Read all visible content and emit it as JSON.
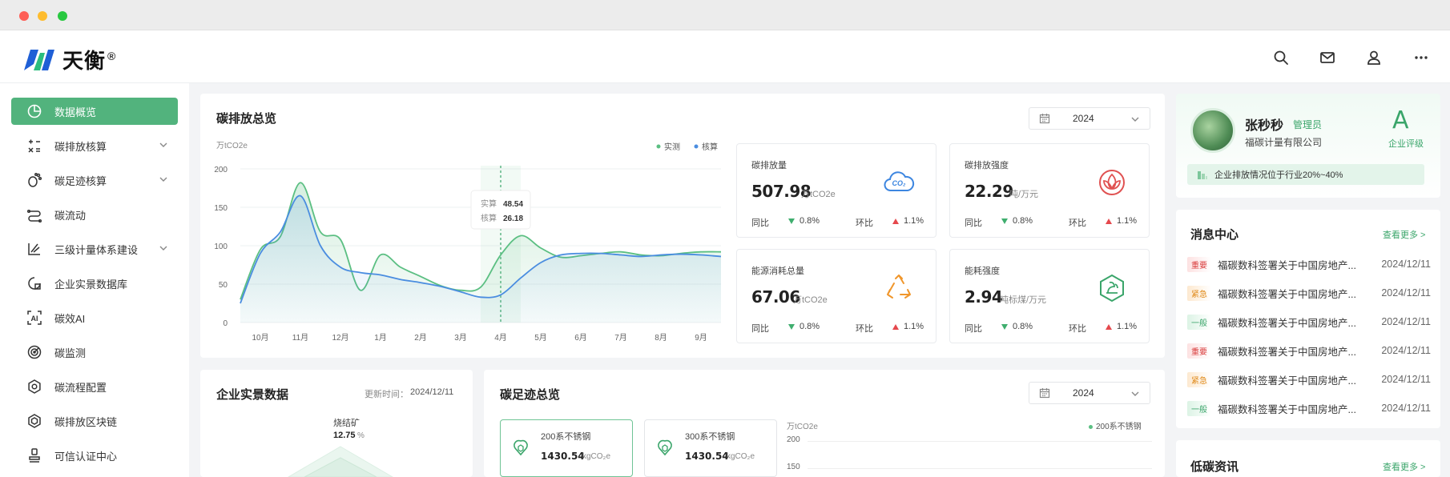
{
  "app": {
    "logo_text": "天衡",
    "logo_mark": "®"
  },
  "colors": {
    "accent": "#52b37d",
    "measured": "#5bbf82",
    "accounted": "#4a8de0",
    "up": "#e5484d",
    "down": "#3fae6e"
  },
  "header_icons": [
    "search-icon",
    "mail-icon",
    "user-icon",
    "more-icon"
  ],
  "sidebar": {
    "items": [
      {
        "label": "数据概览",
        "icon": "pie-chart-icon",
        "active": true,
        "expandable": false
      },
      {
        "label": "碳排放核算",
        "icon": "calculator-icon",
        "active": false,
        "expandable": true
      },
      {
        "label": "碳足迹核算",
        "icon": "footprint-icon",
        "active": false,
        "expandable": true
      },
      {
        "label": "碳流动",
        "icon": "flow-icon",
        "active": false,
        "expandable": false
      },
      {
        "label": "三级计量体系建设",
        "icon": "measure-icon",
        "active": false,
        "expandable": true
      },
      {
        "label": "企业实景数据库",
        "icon": "database-icon",
        "active": false,
        "expandable": false
      },
      {
        "label": "碳效AI",
        "icon": "ai-icon",
        "active": false,
        "expandable": false
      },
      {
        "label": "碳监测",
        "icon": "radar-icon",
        "active": false,
        "expandable": false
      },
      {
        "label": "碳流程配置",
        "icon": "settings-icon",
        "active": false,
        "expandable": false
      },
      {
        "label": "碳排放区块链",
        "icon": "blockchain-icon",
        "active": false,
        "expandable": false
      },
      {
        "label": "可信认证中心",
        "icon": "stamp-icon",
        "active": false,
        "expandable": false
      }
    ]
  },
  "overview": {
    "title": "碳排放总览",
    "year": "2024",
    "unit": "万tCO2e",
    "legend": {
      "measured": "实测",
      "accounted": "核算"
    },
    "tooltip": {
      "measured_label": "实算",
      "measured_value": "48.54",
      "accounted_label": "核算",
      "accounted_value": "26.18"
    },
    "metrics": [
      {
        "label": "碳排放量",
        "value": "507.98",
        "unit": "万tCO2e",
        "yoy_label": "同比",
        "yoy": "0.8%",
        "mom_label": "环比",
        "mom": "1.1%",
        "icon": "co2-cloud-icon",
        "icon_color": "#3d86e0"
      },
      {
        "label": "碳排放强度",
        "value": "22.29",
        "unit": "吨/万元",
        "yoy_label": "同比",
        "yoy": "0.8%",
        "mom_label": "环比",
        "mom": "1.1%",
        "icon": "lotus-icon",
        "icon_color": "#e05252"
      },
      {
        "label": "能源消耗总量",
        "value": "67.06",
        "unit": "万tCO2e",
        "yoy_label": "同比",
        "yoy": "0.8%",
        "mom_label": "环比",
        "mom": "1.1%",
        "icon": "recycle-icon",
        "icon_color": "#f0962b"
      },
      {
        "label": "能耗强度",
        "value": "2.94",
        "unit": "吨标煤/万元",
        "yoy_label": "同比",
        "yoy": "0.8%",
        "mom_label": "环比",
        "mom": "1.1%",
        "icon": "hexagon-leaf-icon",
        "icon_color": "#3aa56a"
      }
    ]
  },
  "chart_data": {
    "type": "area",
    "categories": [
      "10月",
      "11月",
      "12月",
      "1月",
      "2月",
      "3月",
      "4月",
      "5月",
      "6月",
      "7月",
      "8月",
      "9月"
    ],
    "ylim": [
      0,
      200
    ],
    "yticks": [
      0,
      50,
      100,
      150,
      200
    ],
    "ylabel": "万tCO2e",
    "x": [
      -0.5,
      0,
      0.5,
      1,
      1.5,
      2,
      2.5,
      3,
      3.5,
      4,
      4.5,
      5,
      5.5,
      6,
      6.5,
      7,
      7.5,
      8,
      8.5,
      9,
      9.5,
      10,
      10.5,
      11,
      11.5
    ],
    "series": [
      {
        "name": "实测",
        "values": [
          30,
          95,
          112,
          182,
          118,
          108,
          42,
          88,
          72,
          60,
          48,
          42,
          46,
          88,
          113,
          97,
          85,
          87,
          90,
          92,
          88,
          87,
          90,
          92,
          92
        ]
      },
      {
        "name": "核算",
        "values": [
          25,
          90,
          118,
          165,
          100,
          72,
          65,
          62,
          56,
          52,
          47,
          40,
          33,
          36,
          58,
          78,
          88,
          90,
          90,
          88,
          86,
          88,
          89,
          88,
          86
        ]
      }
    ],
    "highlight_category": "4月"
  },
  "profile": {
    "name": "张秒秒",
    "role": "管理员",
    "company": "福碳计量有限公司",
    "grade": "A",
    "grade_label": "企业评级",
    "notice": "企业排放情况位于行业20%~40%"
  },
  "messages": {
    "title": "消息中心",
    "more": "查看更多 >",
    "items": [
      {
        "tag": "重要",
        "level": "red",
        "text": "福碳数科签署关于中国房地产...",
        "date": "2024/12/11"
      },
      {
        "tag": "紧急",
        "level": "orange",
        "text": "福碳数科签署关于中国房地产...",
        "date": "2024/12/11"
      },
      {
        "tag": "一般",
        "level": "green",
        "text": "福碳数科签署关于中国房地产...",
        "date": "2024/12/11"
      },
      {
        "tag": "重要",
        "level": "red",
        "text": "福碳数科签署关于中国房地产...",
        "date": "2024/12/11"
      },
      {
        "tag": "紧急",
        "level": "orange",
        "text": "福碳数科签署关于中国房地产...",
        "date": "2024/12/11"
      },
      {
        "tag": "一般",
        "level": "green",
        "text": "福碳数科签署关于中国房地产...",
        "date": "2024/12/11"
      }
    ]
  },
  "news": {
    "title": "低碳资讯",
    "more": "查看更多 >"
  },
  "enterprise": {
    "title": "企业实景数据",
    "update_label": "更新时间：",
    "update_time": "2024/12/11",
    "item_label": "烧结矿",
    "item_value": "12.75",
    "item_unit": "%"
  },
  "footprint": {
    "title": "碳足迹总览",
    "year": "2024",
    "unit": "万tCO2e",
    "legend": "200系不锈钢",
    "yticks": [
      "200",
      "150"
    ],
    "cards": [
      {
        "name": "200系不锈钢",
        "value": "1430.54",
        "unit": "kgCO₂e",
        "selected": true
      },
      {
        "name": "300系不锈钢",
        "value": "1430.54",
        "unit": "kgCO₂e",
        "selected": false
      }
    ]
  }
}
